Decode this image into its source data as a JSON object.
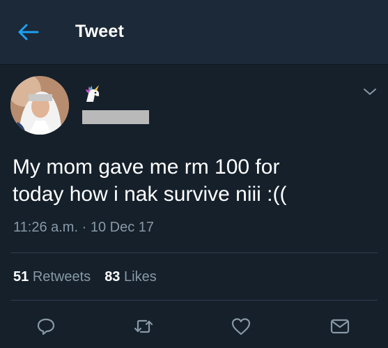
{
  "header": {
    "title": "Tweet",
    "back_icon": "arrow-left-icon"
  },
  "tweet": {
    "author_emoji": "unicorn-emoji",
    "author_handle_redacted": true,
    "text_line1": "My mom gave me rm 100 for",
    "text_line2": "today how i nak survive niii :((",
    "time": "11:26 a.m.",
    "separator": "·",
    "date": "10 Dec 17",
    "retweets_count": "51",
    "retweets_label": "Retweets",
    "likes_count": "83",
    "likes_label": "Likes"
  },
  "actions": [
    "reply-icon",
    "retweet-icon",
    "like-icon",
    "share-icon"
  ],
  "colors": {
    "background": "#15202b",
    "header_bg": "#1c2938",
    "accent": "#1da1f2",
    "muted": "#8899a6",
    "divider": "#2f3d4c"
  }
}
